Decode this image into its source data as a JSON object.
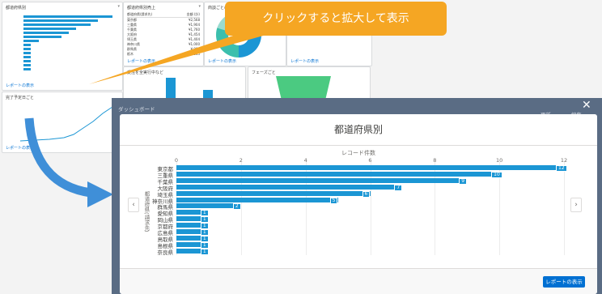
{
  "callout": {
    "text": "クリックすると拡大して表示"
  },
  "dashboard": {
    "card1_title": "都道府県別",
    "card2_title": "都道府県別売上",
    "card2_headers": [
      "都道府県(請求先)",
      "金額 (計)"
    ],
    "card2_rows": [
      [
        "東京都",
        "¥2,568"
      ],
      [
        "三重県",
        "¥1,904"
      ],
      [
        "千葉県",
        "¥1,760"
      ],
      [
        "大阪府",
        "¥1,454"
      ],
      [
        "埼玉県",
        "¥1,404"
      ],
      [
        "神奈川県",
        "¥1,000"
      ],
      [
        "群馬県",
        "¥ 900"
      ],
      [
        "栃木",
        "¥ 815"
      ]
    ],
    "card3_title": "商談ごとの売上",
    "card4_title": "受注を全実行中など",
    "card5_title": "フェーズごと",
    "card6_title": "完了予定日ごと",
    "link_label": "レポートの表示",
    "dashboard_label": "ダッシュボード"
  },
  "header_links": {
    "refresh": "更新",
    "edit": "編集"
  },
  "modal": {
    "title": "都道府県別",
    "x_axis_title": "レコード件数",
    "y_axis_title": "都道府県(請求先)",
    "report_button": "レポートの表示",
    "close_label": "✕",
    "prev_label": "‹",
    "next_label": "›"
  },
  "chart_data": {
    "type": "bar",
    "orientation": "horizontal",
    "title": "都道府県別",
    "xlabel": "レコード件数",
    "ylabel": "都道府県(請求先)",
    "xlim": [
      0,
      12
    ],
    "xticks": [
      0,
      2,
      4,
      6,
      8,
      10,
      12
    ],
    "categories": [
      "東京都",
      "三重県",
      "千葉県",
      "大阪府",
      "埼玉県",
      "神奈川県",
      "群馬県",
      "愛知県",
      "岡山県",
      "京都府",
      "広島県",
      "鳥取県",
      "島根県",
      "奈良県"
    ],
    "values": [
      12,
      10,
      9,
      7,
      6,
      5,
      2,
      1,
      1,
      1,
      1,
      1,
      1,
      1
    ],
    "bar_color": "#1b96d4"
  }
}
